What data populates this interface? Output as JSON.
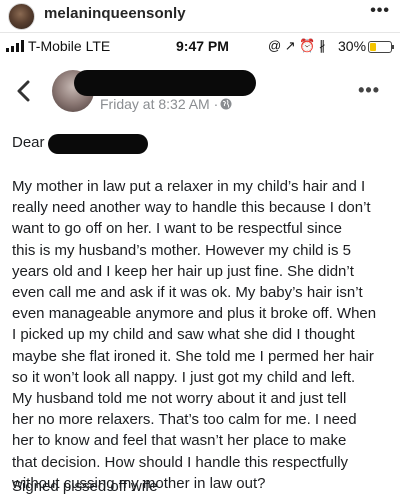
{
  "instagram": {
    "username": "melaninqueensonly",
    "more_label": "•••"
  },
  "status_bar": {
    "carrier": "T-Mobile  LTE",
    "time": "9:47 PM",
    "icons": "@ ↗ ⏰ ∦",
    "battery_percent": "30%",
    "battery_level": 0.3
  },
  "post": {
    "timestamp": "Friday at 8:32 AM ·",
    "more_label": "•••",
    "greeting": "Dear",
    "body_lines": [
      "My mother in law put a relaxer in my child’s hair and I",
      "really need another way to handle this because I don’t",
      "want to go off on her.  I want to be respectful since",
      "this is my husband’s mother. However my child is 5",
      "years old and I keep her hair up just fine. She didn’t",
      "even call me and ask if it was ok. My baby’s hair isn’t",
      "even manageable anymore and plus it broke off. When",
      "I picked up my child and saw what she did I thought",
      "maybe she flat ironed it. She told me I permed her hair",
      "so it won’t look all nappy. I just got my child and left.",
      "My husband told me not worry about it and just tell",
      "her no more relaxers. That’s too calm for me. I need",
      "her to know and feel that wasn’t her place to make",
      "that decision. How should I handle this respectfully",
      "without cussing my mother in law out?"
    ],
    "signoff": "Signed pissed off wife"
  }
}
